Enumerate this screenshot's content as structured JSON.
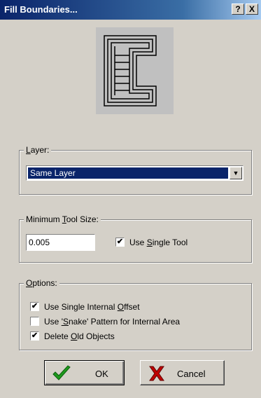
{
  "window": {
    "title": "Fill Boundaries...",
    "help_label": "?",
    "close_label": "X"
  },
  "layer_group": {
    "label_pre": "",
    "label_key": "L",
    "label_post": "ayer:",
    "selected": "Same Layer"
  },
  "tool_group": {
    "label_pre": "Minimum ",
    "label_key": "T",
    "label_post": "ool Size:",
    "value": "0.005",
    "single_tool": {
      "label_pre": "Use ",
      "label_key": "S",
      "label_post": "ingle Tool",
      "checked": true
    }
  },
  "options_group": {
    "label_pre": "",
    "label_key": "O",
    "label_post": "ptions:",
    "items": [
      {
        "label_pre": "Use Single Internal ",
        "label_key": "O",
        "label_post": "ffset",
        "checked": true
      },
      {
        "label_pre": "Use ",
        "label_key": "'S",
        "label_post": "nake' Pattern for Internal Area",
        "checked": false
      },
      {
        "label_pre": "Delete ",
        "label_key": "O",
        "label_post": "ld Objects",
        "checked": true
      }
    ]
  },
  "buttons": {
    "ok_label": "OK",
    "cancel_label": "Cancel"
  },
  "icons": {
    "ok": "checkmark-icon",
    "cancel": "x-icon",
    "preview": "fill-boundaries-preview-icon"
  },
  "colors": {
    "title_bar": "#0a246a",
    "selection": "#0a246a",
    "ok_check": "#1e9a1e",
    "cancel_x": "#c00000"
  }
}
